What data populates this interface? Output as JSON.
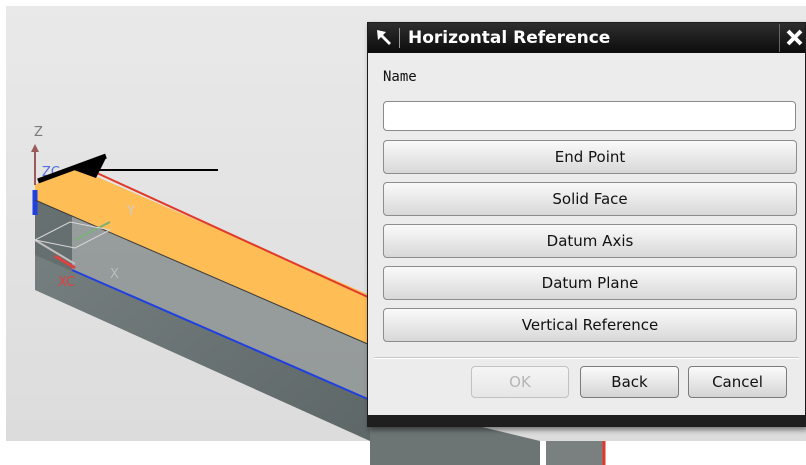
{
  "viewport": {
    "background_color": "#e3e3e3",
    "part_top_color": "#ffbe55",
    "part_side_color": "#6f7878",
    "axes": {
      "z_label": "Z",
      "zc_label": "ZC",
      "xc_label": "XC",
      "x_label": "X",
      "y_label": "Y"
    }
  },
  "dialog": {
    "title": "Horizontal Reference",
    "name_label": "Name",
    "name_value": "",
    "options": [
      "End Point",
      "Solid Face",
      "Datum Axis",
      "Datum Plane",
      "Vertical Reference"
    ],
    "ok_label": "OK",
    "back_label": "Back",
    "cancel_label": "Cancel"
  }
}
